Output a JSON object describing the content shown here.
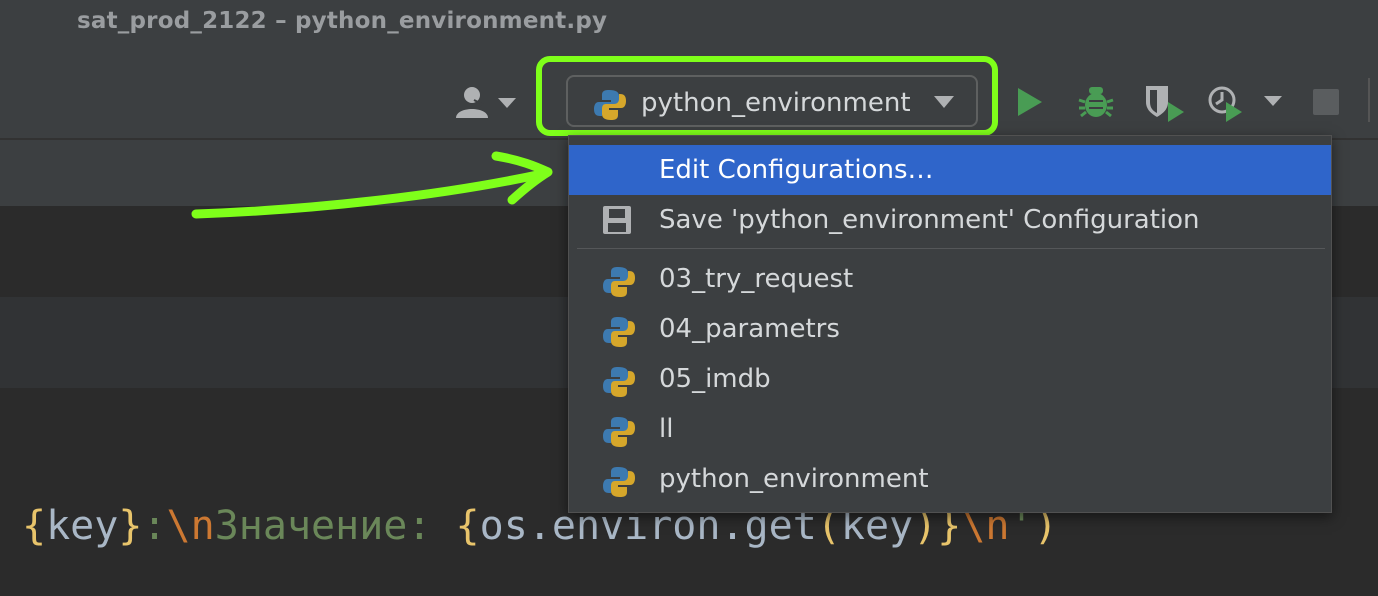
{
  "window": {
    "title": "sat_prod_2122 – python_environment.py"
  },
  "toolbar": {
    "vcs_icon": "user-icon",
    "run_config": {
      "label": "python_environment",
      "icon": "python-icon"
    },
    "buttons": [
      "run-icon",
      "debug-icon",
      "coverage-icon",
      "profile-icon",
      "stop-icon"
    ]
  },
  "menu": {
    "items": [
      {
        "label": "Edit Configurations…",
        "icon": "",
        "selected": true
      },
      {
        "label": "Save 'python_environment' Configuration",
        "icon": "save-icon"
      },
      {
        "label": "03_try_request",
        "icon": "python-icon"
      },
      {
        "label": "04_parametrs",
        "icon": "python-icon"
      },
      {
        "label": "05_imdb",
        "icon": "python-icon"
      },
      {
        "label": "ll",
        "icon": "python-icon"
      },
      {
        "label": "python_environment",
        "icon": "python-icon"
      }
    ]
  },
  "code": {
    "t1": "{",
    "t2": "key",
    "t3": "}",
    "t4": ":",
    "t5": "\\n",
    "t6": "Значение: ",
    "t7": "{",
    "t8": "os.environ.get",
    "t9": "(",
    "t10": "key",
    "t11": ")",
    "t12": "}",
    "t13": "\\n",
    "t14": "'",
    "t15": ")"
  },
  "colors": {
    "highlight": "#7fff1a",
    "selection": "#2f65ca",
    "run_green": "#499c54"
  }
}
